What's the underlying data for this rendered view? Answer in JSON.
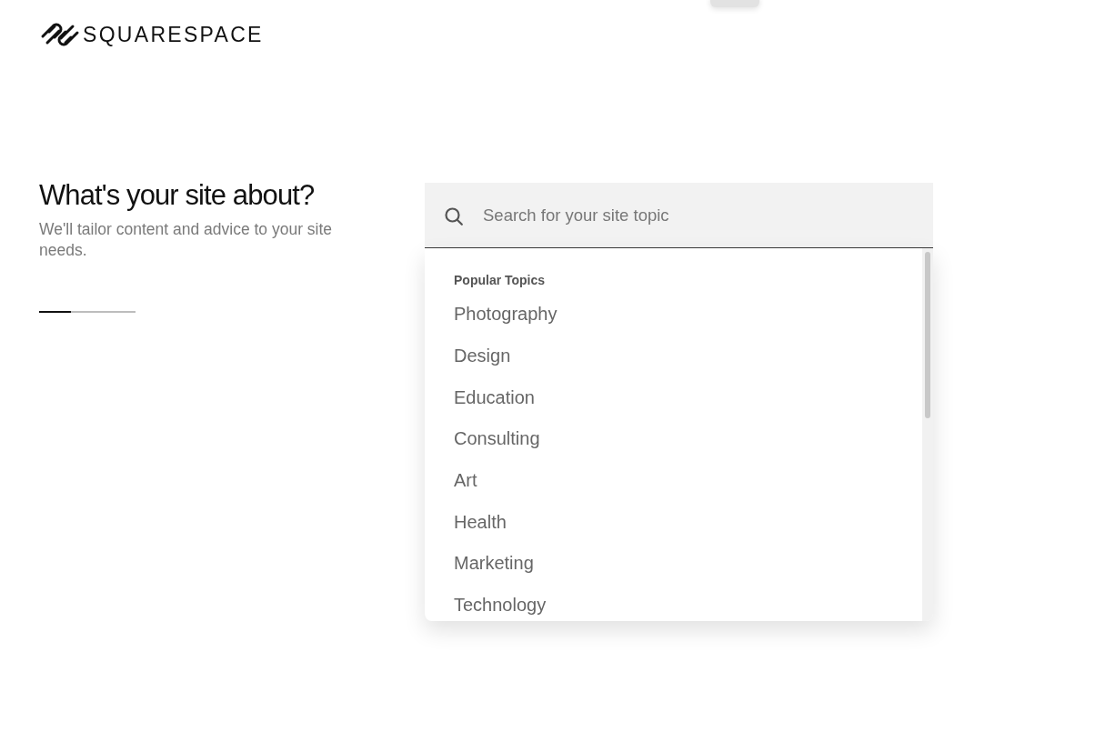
{
  "logo": {
    "wordmark": "SQUARESPACE"
  },
  "intro": {
    "heading": "What's your site about?",
    "subheading": "We'll tailor content and advice to your site needs.",
    "progress": {
      "level": 0.33
    }
  },
  "search": {
    "placeholder": "Search for your site topic"
  },
  "dropdown": {
    "section_label": "Popular Topics",
    "items": [
      {
        "label": "Photography",
        "selected": false
      },
      {
        "label": "Design",
        "selected": false
      },
      {
        "label": "Education",
        "selected": false
      },
      {
        "label": "Consulting",
        "selected": false
      },
      {
        "label": "Art",
        "selected": false
      },
      {
        "label": "Health",
        "selected": false
      },
      {
        "label": "Marketing",
        "selected": false
      },
      {
        "label": "Technology",
        "selected": false
      }
    ]
  }
}
